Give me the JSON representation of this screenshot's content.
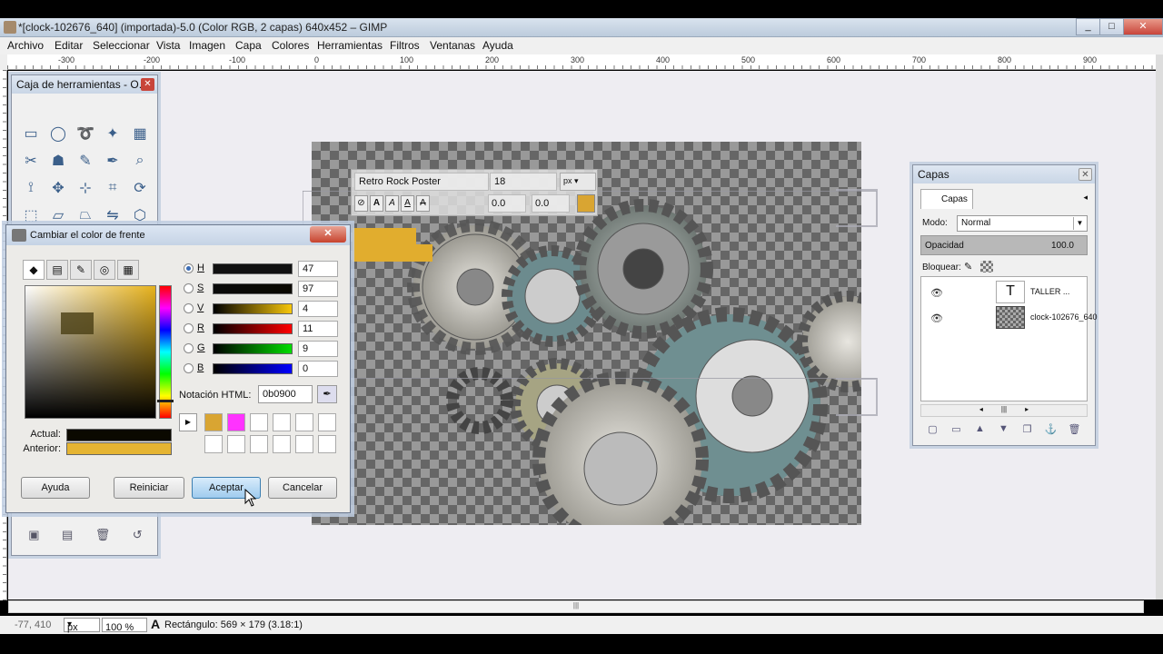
{
  "window": {
    "title": "*[clock-102676_640] (importada)-5.0 (Color RGB, 2 capas) 640x452 – GIMP"
  },
  "menu": [
    "Archivo",
    "Editar",
    "Seleccionar",
    "Vista",
    "Imagen",
    "Capa",
    "Colores",
    "Herramientas",
    "Filtros",
    "Ventanas",
    "Ayuda"
  ],
  "ruler": [
    "-300",
    "-200",
    "-100",
    "0",
    "100",
    "200",
    "300",
    "400",
    "500",
    "600",
    "700",
    "800",
    "900"
  ],
  "toolbox": {
    "title": "Caja de herramientas - O...",
    "tools": [
      "rect-select-icon",
      "ellipse-select-icon",
      "lasso-icon",
      "fuzzy-select-icon",
      "color-select-icon",
      "scissors-icon",
      "foreground-select-icon",
      "paths-icon",
      "color-picker-icon",
      "zoom-icon",
      "measure-icon",
      "move-icon",
      "align-icon",
      "crop-icon",
      "rotate-icon",
      "scale-icon",
      "shear-icon",
      "perspective-icon",
      "flip-icon",
      "cage-icon"
    ]
  },
  "text_tool": {
    "font": "Retro Rock Poster",
    "size": "18",
    "unit": "px",
    "indent": "0.0",
    "spacing": "0.0",
    "color": "#d9a532"
  },
  "color_dialog": {
    "title": "Cambiar el color de frente",
    "channels": [
      {
        "label": "H",
        "value": "47",
        "selected": true
      },
      {
        "label": "S",
        "value": "97",
        "selected": false
      },
      {
        "label": "V",
        "value": "4",
        "selected": false
      },
      {
        "label": "R",
        "value": "11",
        "selected": false
      },
      {
        "label": "G",
        "value": "9",
        "selected": false
      },
      {
        "label": "B",
        "value": "0",
        "selected": false
      }
    ],
    "html_label": "Notación HTML:",
    "html_value": "0b0900",
    "history_colors": [
      "#d9a532",
      "#ff33ff"
    ],
    "current_label": "Actual:",
    "previous_label": "Anterior:",
    "current_color": "#0b0900",
    "previous_color": "#e5b432",
    "buttons": {
      "help": "Ayuda",
      "reset": "Reiniciar",
      "ok": "Aceptar",
      "cancel": "Cancelar"
    }
  },
  "layers": {
    "title": "Capas",
    "tab": "Capas",
    "mode_label": "Modo:",
    "mode_value": "Normal",
    "opacity_label": "Opacidad",
    "opacity_value": "100.0",
    "lock_label": "Bloquear:",
    "items": [
      {
        "name": "TALLER ...",
        "type": "text"
      },
      {
        "name": "clock-102676_640",
        "type": "image"
      }
    ]
  },
  "status": {
    "coords": "-77, 410",
    "unit": "px",
    "zoom": "100 %",
    "message": "Rectángulo: 569 × 179  (3.18:1)"
  }
}
